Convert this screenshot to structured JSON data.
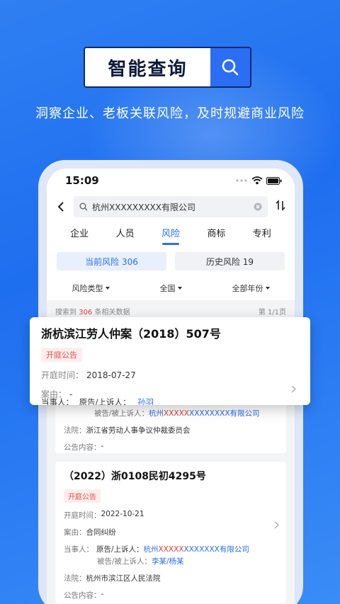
{
  "hero": {
    "title": "智能查询",
    "tagline": "洞察企业、老板关联风险，及时规避商业风险"
  },
  "status": {
    "time": "15:09"
  },
  "search": {
    "value": "杭州XXXXXXXXX有限公司"
  },
  "tabs": [
    {
      "label": "企业"
    },
    {
      "label": "人员"
    },
    {
      "label": "风险"
    },
    {
      "label": "商标"
    },
    {
      "label": "专利"
    }
  ],
  "risk_toggle": {
    "current": "当前风险 306",
    "history": "历史风险 19"
  },
  "filters": {
    "type": "风险类型",
    "region": "全国",
    "year": "全部年份"
  },
  "results_meta": {
    "prefix": "搜索到 ",
    "count": "306",
    "suffix": " 条相关数据",
    "page": "第 1/1页"
  },
  "float_card": {
    "title": "浙杭滨江劳人仲案（2018）507号",
    "tag": "开庭公告",
    "date_label": "开庭时间：",
    "date": "2018-07-27",
    "cause_label": "案由：",
    "cause": "-",
    "party_label": "当事人：",
    "party_role": "原告/上诉人：",
    "party_name": "孙羽"
  },
  "card1": {
    "defendant_label": "被告/被上诉人：",
    "defendant_a": "杭州",
    "defendant_x": "XXXXX",
    "defendant_b": "XXXXXXXX有限公司",
    "court_label": "法院：",
    "court": "浙江省劳动人事争议仲裁委员会",
    "notice_label": "公告内容：",
    "notice": "-"
  },
  "card2": {
    "title": "（2022）浙0108民初4295号",
    "tag": "开庭公告",
    "date_label": "开庭时间：",
    "date": "2022-10-21",
    "cause_label": "案由：",
    "cause": "合同纠纷",
    "party_label": "当事人：",
    "plaintiff_label": "原告/上诉人：",
    "plaintiff_a": "杭州",
    "plaintiff_x": "XXXXX",
    "plaintiff_b": "XXXXXXX有限公司",
    "defendant_label": "被告/被上诉人：",
    "defendant": "李某/杨某",
    "court_label": "法院：",
    "court": "杭州市滨江区人民法院",
    "notice_label": "公告内容：",
    "notice": "-"
  },
  "colors": {
    "accent": "#2a6ef3",
    "danger": "#e23b3b",
    "background": "#2f7ff2"
  }
}
